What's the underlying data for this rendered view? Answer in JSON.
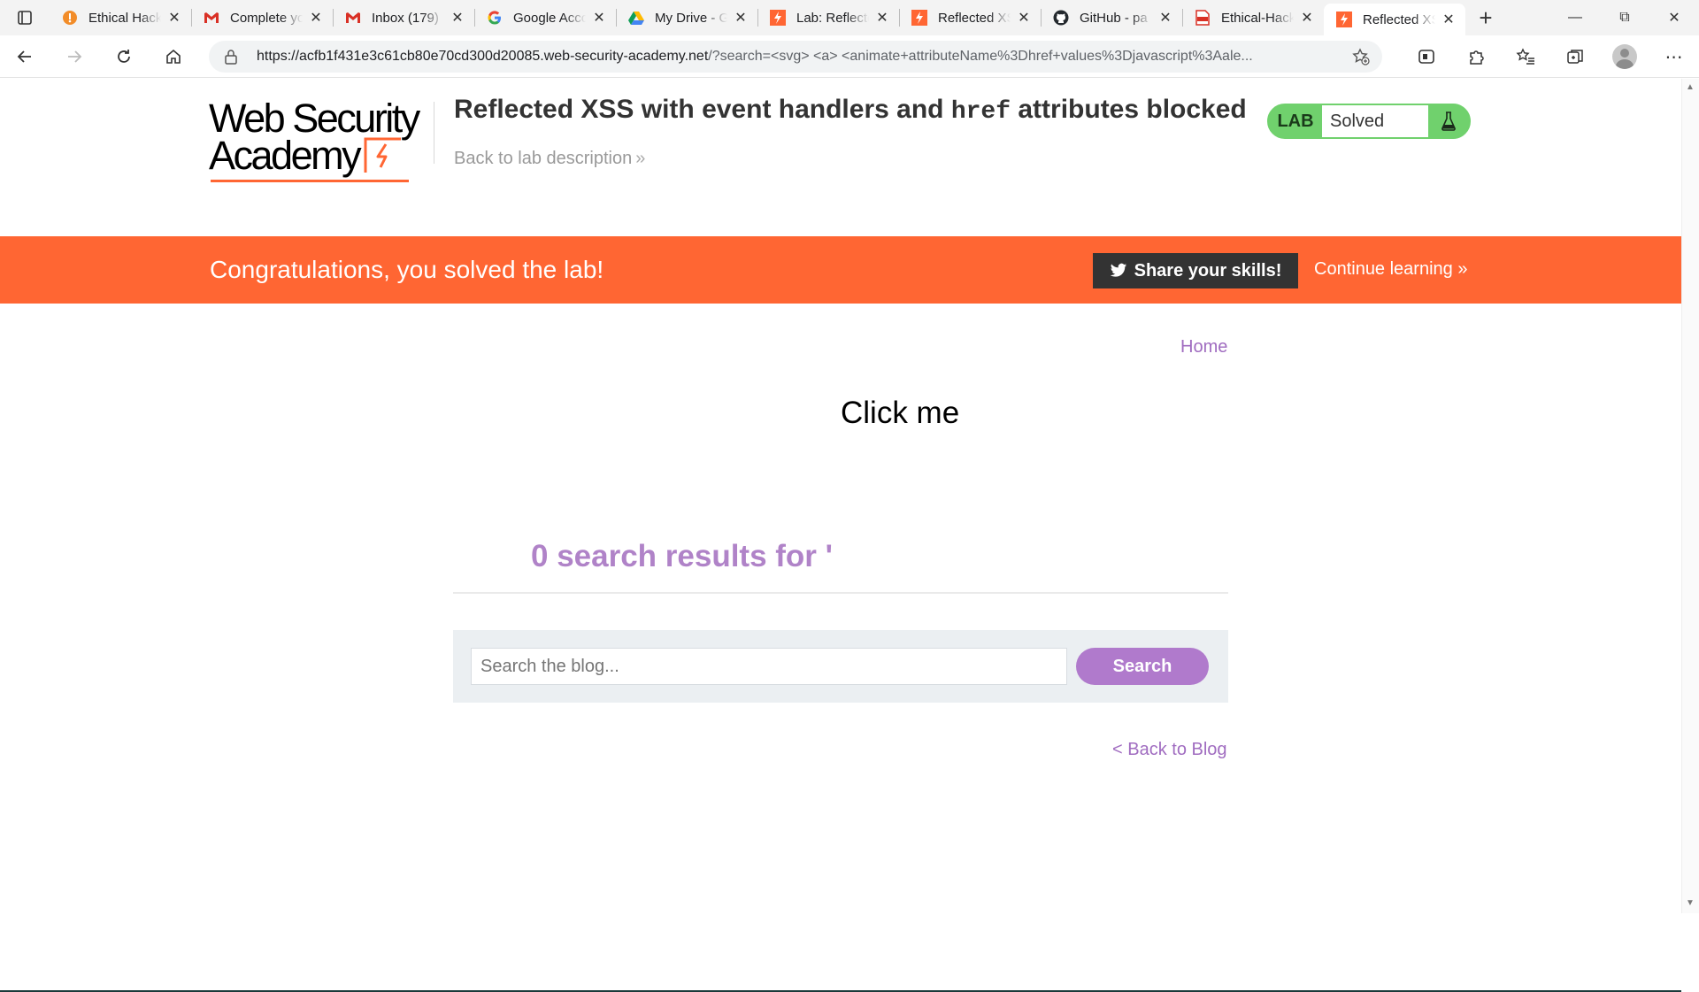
{
  "browser": {
    "tabs": [
      {
        "title": "Ethical Hacking",
        "icon": "torch-favicon",
        "color": "#f28c28"
      },
      {
        "title": "Complete your",
        "icon": "gmail-favicon",
        "color": "#d93025"
      },
      {
        "title": "Inbox (179)",
        "icon": "gmail-favicon",
        "color": "#d93025"
      },
      {
        "title": "Google Account",
        "icon": "google-favicon",
        "color": "#4285f4"
      },
      {
        "title": "My Drive - Goo",
        "icon": "drive-favicon",
        "color": "#0f9d58"
      },
      {
        "title": "Lab: Reflected",
        "icon": "portswigger-favicon",
        "color": "#ff6633"
      },
      {
        "title": "Reflected XSS",
        "icon": "portswigger-favicon",
        "color": "#ff6633"
      },
      {
        "title": "GitHub - pa",
        "icon": "github-favicon",
        "color": "#24292e"
      },
      {
        "title": "Ethical-Hacki",
        "icon": "pdf-favicon",
        "color": "#d93025"
      },
      {
        "title": "Reflected XSS",
        "icon": "portswigger-favicon",
        "color": "#ff6633",
        "active": true
      }
    ],
    "url_host": "https://acfb1f431e3c61cb80e70cd300d20085.web-security-academy.net",
    "url_rest": "/?search=<svg> <a> <animate+attributeName%3Dhref+values%3Djavascript%3Aale..."
  },
  "header": {
    "logo_line1": "Web Security",
    "logo_line2": "Academy",
    "title_before": "Reflected XSS with event handlers and ",
    "title_code": "href",
    "title_after": " attributes blocked",
    "back_to_description": "Back to lab description",
    "lab_label": "LAB",
    "lab_status": "Solved",
    "accent": "#ff6633",
    "status_color": "#70d16d"
  },
  "banner": {
    "message": "Congratulations, you solved the lab!",
    "share_label": "Share your skills!",
    "continue_label": "Continue learning"
  },
  "content": {
    "home_link": "Home",
    "click_me": "Click me",
    "results_text": "0 search results for '",
    "search_placeholder": "Search the blog...",
    "search_button": "Search",
    "back_to_blog": "< Back to Blog",
    "link_color": "#a06cc0"
  }
}
